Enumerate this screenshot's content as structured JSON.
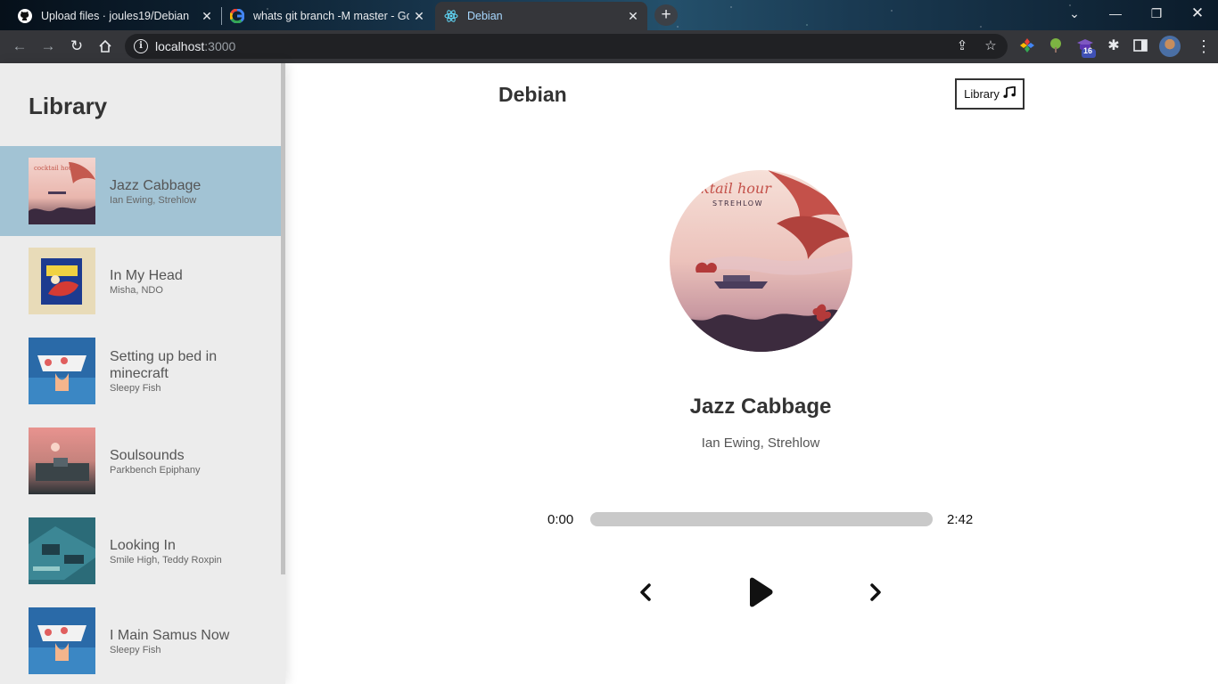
{
  "browser": {
    "tabs": [
      {
        "title": "Upload files · joules19/Debian",
        "icon": "github-icon"
      },
      {
        "title": "whats git branch -M master - Go",
        "icon": "google-icon"
      },
      {
        "title": "Debian",
        "icon": "react-icon",
        "active": true
      }
    ],
    "url_host": "localhost",
    "url_port": ":3000",
    "extension_badge": "16"
  },
  "sidebar": {
    "title": "Library",
    "songs": [
      {
        "name": "Jazz Cabbage",
        "artist": "Ian Ewing, Strehlow",
        "active": true
      },
      {
        "name": "In My Head",
        "artist": "Misha, NDO"
      },
      {
        "name": "Setting up bed in minecraft",
        "artist": "Sleepy Fish"
      },
      {
        "name": "Soulsounds",
        "artist": "Parkbench Epiphany"
      },
      {
        "name": "Looking In",
        "artist": "Smile High, Teddy Roxpin"
      },
      {
        "name": "I Main Samus Now",
        "artist": "Sleepy Fish"
      }
    ]
  },
  "header": {
    "brand": "Debian",
    "library_button": "Library"
  },
  "player": {
    "title": "Jazz Cabbage",
    "artist": "Ian Ewing, Strehlow",
    "current_time": "0:00",
    "total_time": "2:42",
    "progress": 0
  },
  "colors": {
    "active_song_bg": "#a2c3d4",
    "sidebar_bg": "#ececec"
  }
}
